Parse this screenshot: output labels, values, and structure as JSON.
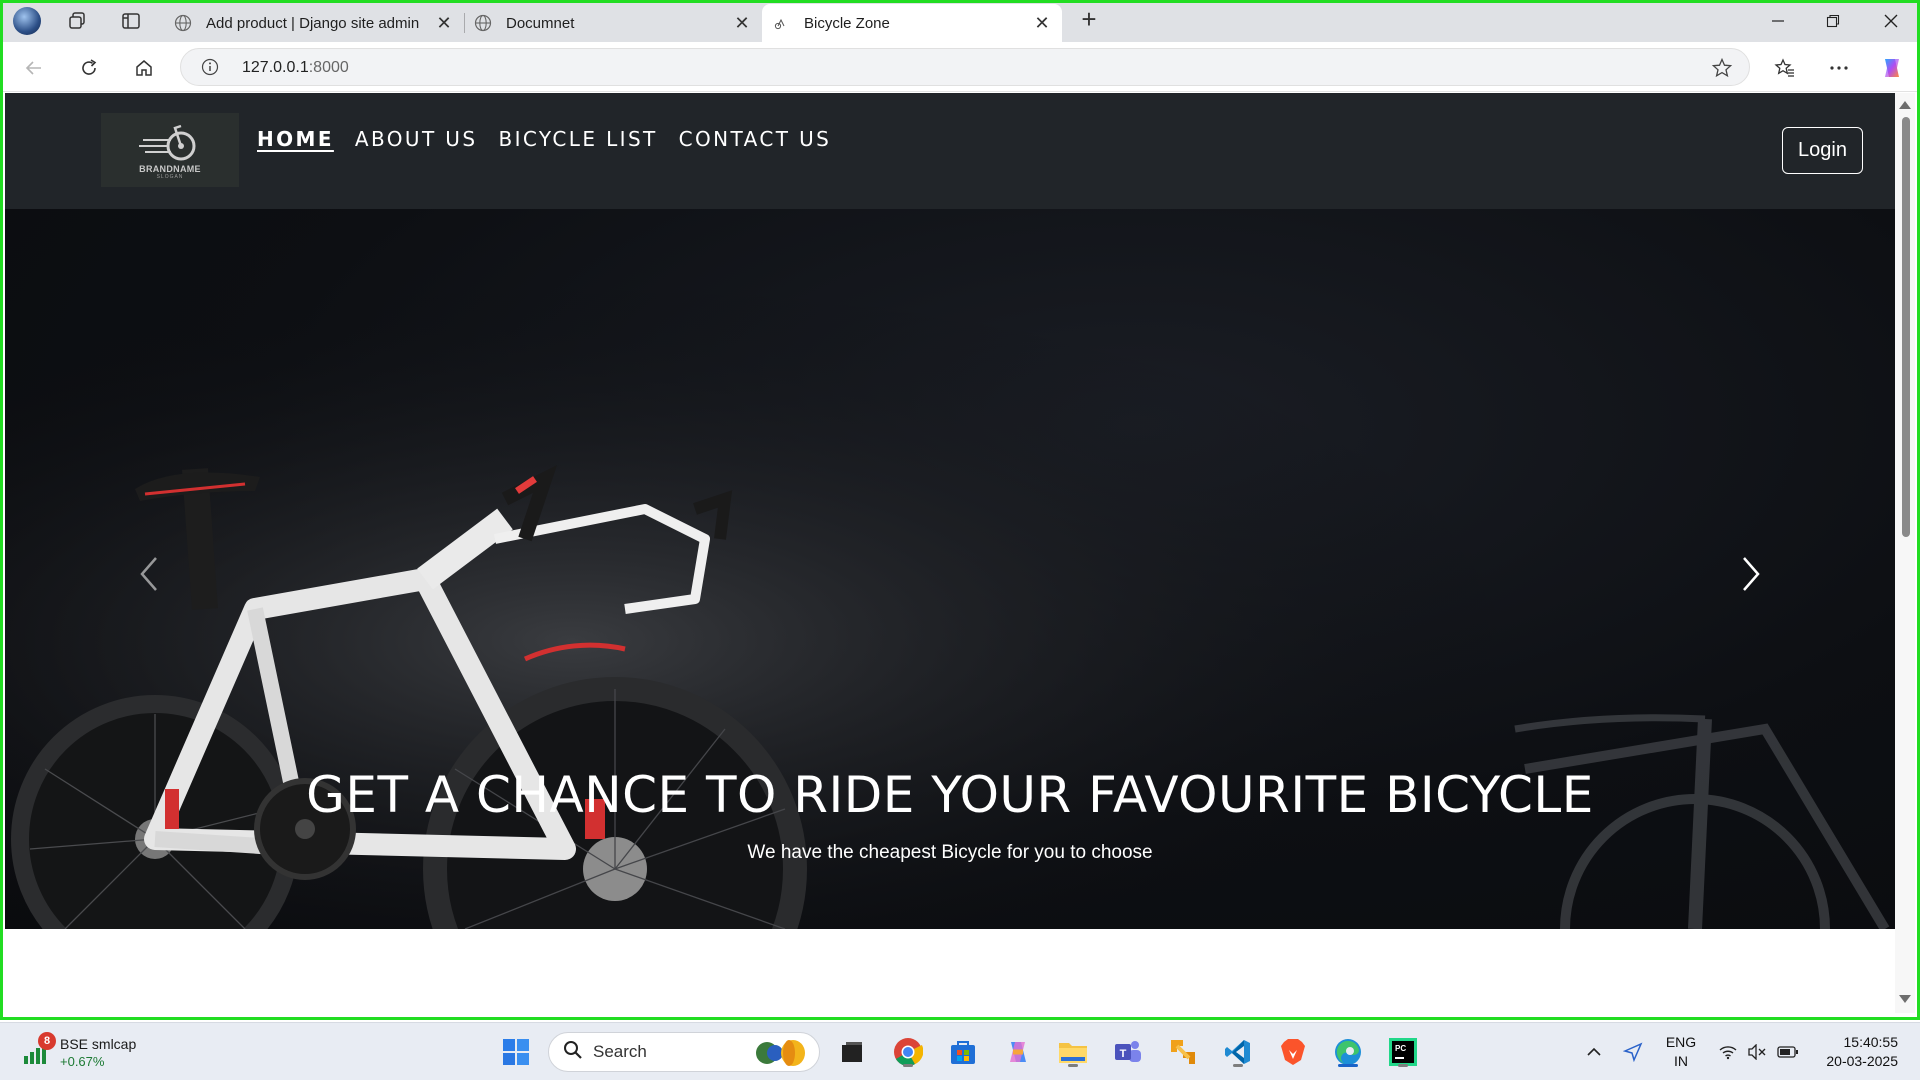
{
  "browser": {
    "tabs": [
      {
        "title": "Add product | Django site admin",
        "active": false
      },
      {
        "title": "Documnet",
        "active": false
      },
      {
        "title": "Bicycle Zone",
        "active": true
      }
    ],
    "address": {
      "host": "127.0.0.1",
      "port": ":8000"
    }
  },
  "site": {
    "brand": {
      "name": "BRANDNAME",
      "slogan": "SLOGAN"
    },
    "nav": [
      {
        "label": "HOME",
        "active": true
      },
      {
        "label": "ABOUT US",
        "active": false
      },
      {
        "label": "BICYCLE LIST",
        "active": false
      },
      {
        "label": "CONTACT US",
        "active": false
      }
    ],
    "login_label": "Login",
    "hero": {
      "heading": "GET A CHANCE TO RIDE YOUR FAVOURITE BICYCLE",
      "subheading": "We have the cheapest Bicycle for you to choose"
    }
  },
  "taskbar": {
    "widget": {
      "title": "BSE smlcap",
      "change": "+0.67%",
      "badge": "8"
    },
    "search_placeholder": "Search",
    "apps": [
      "windows-start",
      "task-view",
      "chrome",
      "microsoft-store",
      "copilot",
      "file-explorer",
      "teams",
      "git-tool",
      "vscode",
      "brave",
      "edge",
      "pycharm"
    ],
    "lang": {
      "line1": "ENG",
      "line2": "IN"
    },
    "time": "15:40:55",
    "date": "20-03-2025"
  },
  "colors": {
    "navbar": "#212529",
    "selection_frame": "#22dd22",
    "accent": "#e23b3b"
  }
}
